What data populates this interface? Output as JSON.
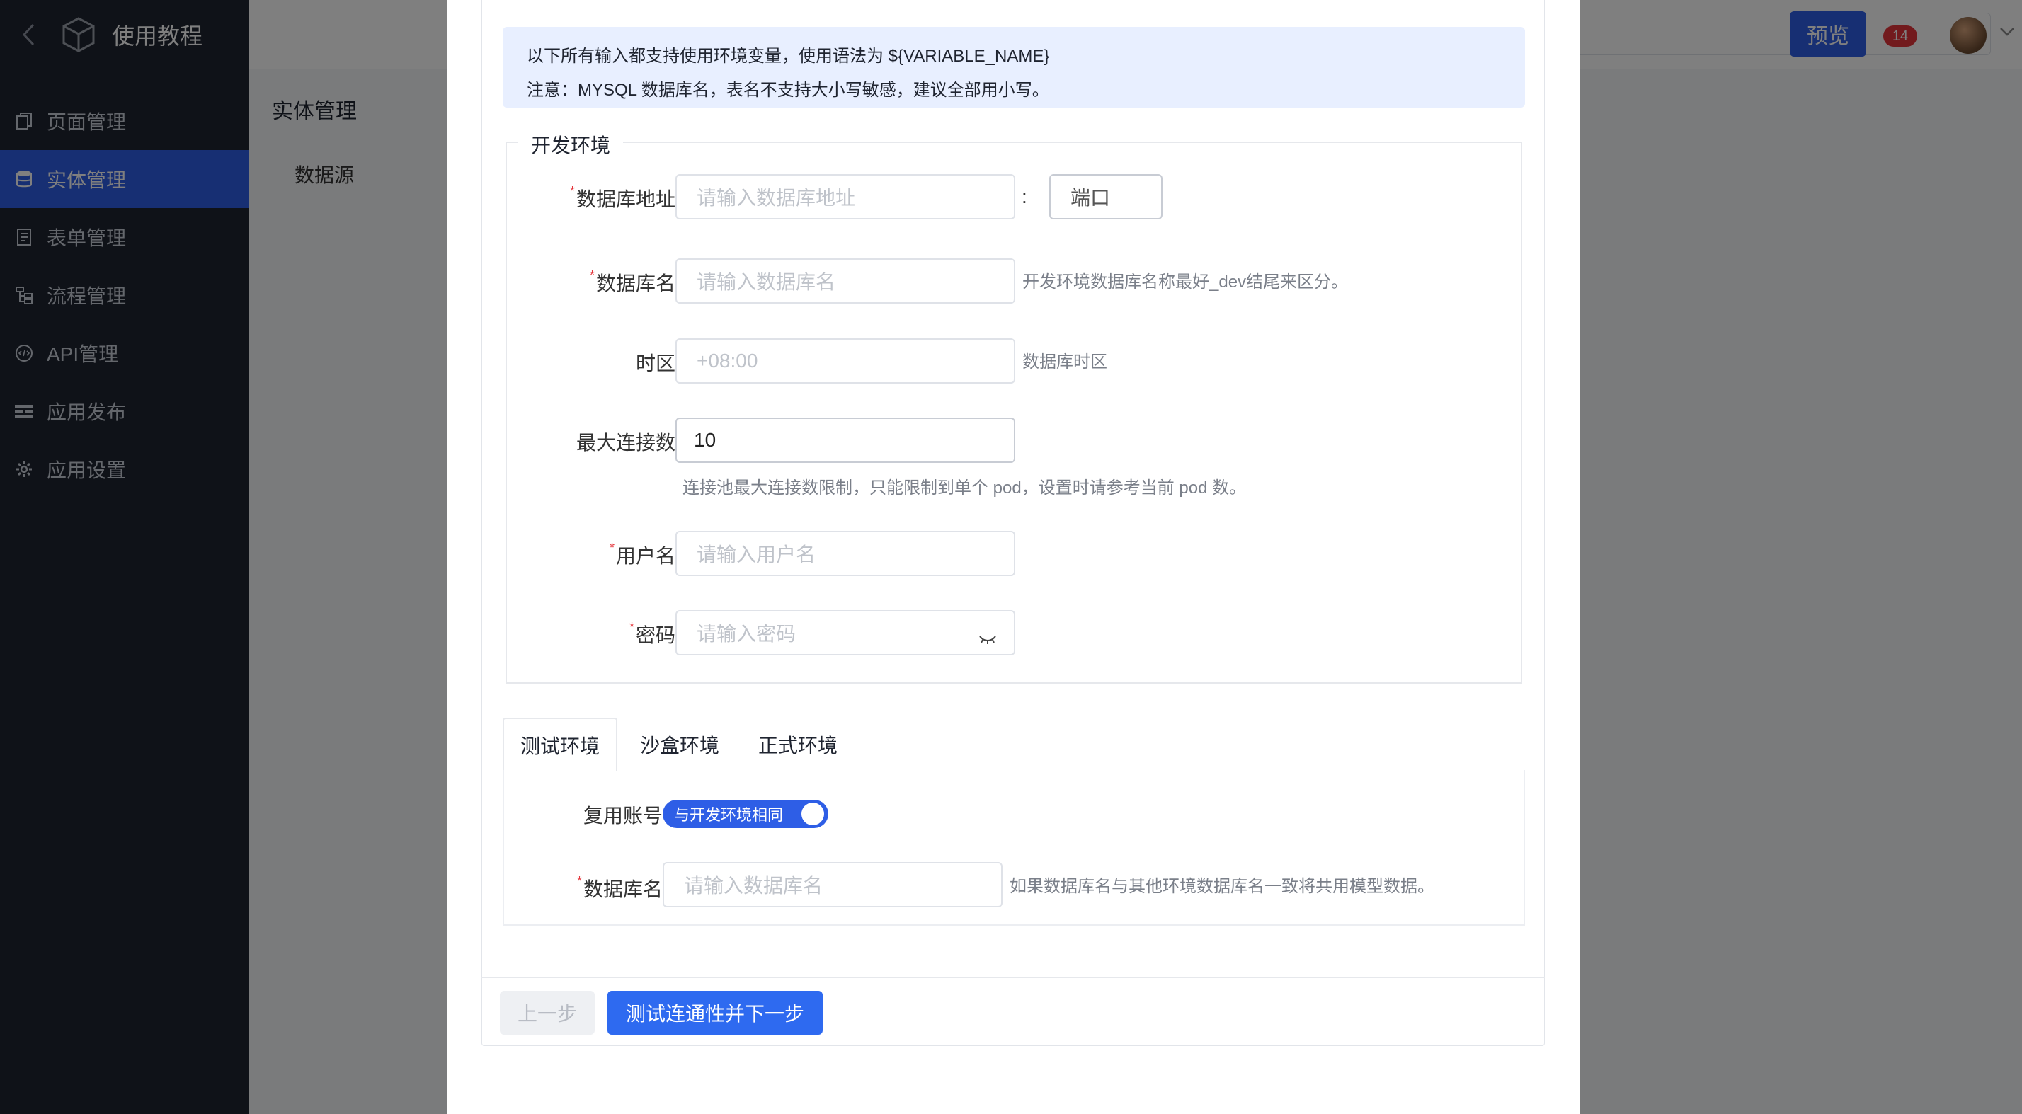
{
  "app": {
    "title": "使用教程"
  },
  "sidebar": {
    "items": [
      {
        "label": "页面管理",
        "icon": "pages-icon"
      },
      {
        "label": "实体管理",
        "icon": "database-icon",
        "active": true
      },
      {
        "label": "表单管理",
        "icon": "form-icon"
      },
      {
        "label": "流程管理",
        "icon": "flow-icon"
      },
      {
        "label": "API管理",
        "icon": "api-icon"
      },
      {
        "label": "应用发布",
        "icon": "publish-icon"
      },
      {
        "label": "应用设置",
        "icon": "gear-icon"
      }
    ]
  },
  "header": {
    "preview_label": "预览",
    "notification_count": "14"
  },
  "page": {
    "title": "实体管理",
    "subtitle": "数据源"
  },
  "modal": {
    "info_line1": "以下所有输入都支持使用环境变量，使用语法为 ${VARIABLE_NAME}",
    "info_line2": "注意：MYSQL 数据库名，表名不支持大小写敏感，建议全部用小写。",
    "dev_section_title": "开发环境",
    "dev": {
      "host_label": "数据库地址",
      "host_placeholder": "请输入数据库地址",
      "colon": ":",
      "port_placeholder": "端口",
      "dbname_label": "数据库名",
      "dbname_placeholder": "请输入数据库名",
      "dbname_hint": "开发环境数据库名称最好_dev结尾来区分。",
      "timezone_label": "时区",
      "timezone_placeholder": "+08:00",
      "timezone_hint": "数据库时区",
      "maxconn_label": "最大连接数",
      "maxconn_value": "10",
      "maxconn_hint": "连接池最大连接数限制，只能限制到单个 pod，设置时请参考当前 pod 数。",
      "username_label": "用户名",
      "username_placeholder": "请输入用户名",
      "password_label": "密码",
      "password_placeholder": "请输入密码"
    },
    "tabs": [
      {
        "label": "测试环境",
        "active": true
      },
      {
        "label": "沙盒环境"
      },
      {
        "label": "正式环境"
      }
    ],
    "test": {
      "reuse_label": "复用账号",
      "reuse_switch_text": "与开发环境相同",
      "reuse_on": true,
      "dbname_label": "数据库名",
      "dbname_placeholder": "请输入数据库名",
      "dbname_hint": "如果数据库名与其他环境数据库名一致将共用模型数据。"
    },
    "buttons": {
      "prev": "上一步",
      "next": "测试连通性并下一步"
    }
  },
  "colors": {
    "accent": "#2e5ee6",
    "required": "#e5353b",
    "sidebar_bg": "#1f2430"
  }
}
